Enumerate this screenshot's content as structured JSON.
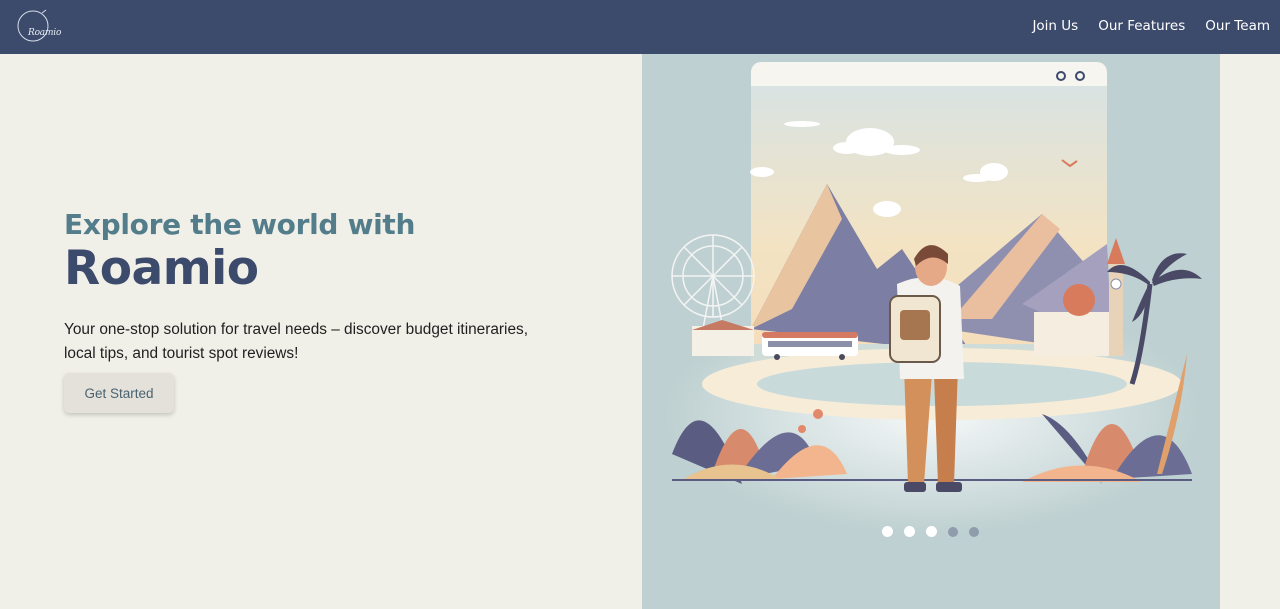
{
  "brand": {
    "logo_text": "Roamio"
  },
  "nav": {
    "links": [
      {
        "label": "Join Us"
      },
      {
        "label": "Our Features"
      },
      {
        "label": "Our Team"
      }
    ]
  },
  "hero": {
    "subheading": "Explore the world with",
    "heading": "Roamio",
    "description": "Your one-stop solution for travel needs – discover budget itineraries, local tips, and tourist spot reviews!",
    "cta_label": "Get Started"
  },
  "carousel": {
    "slide_count": 5,
    "active_slide": [
      1,
      2,
      3
    ]
  },
  "colors": {
    "navbar": "#3c4a6c",
    "background": "#f0efe8",
    "accent_teal": "#537d8a",
    "heading_navy": "#3c4a6c",
    "panel": "#bed0d1"
  }
}
